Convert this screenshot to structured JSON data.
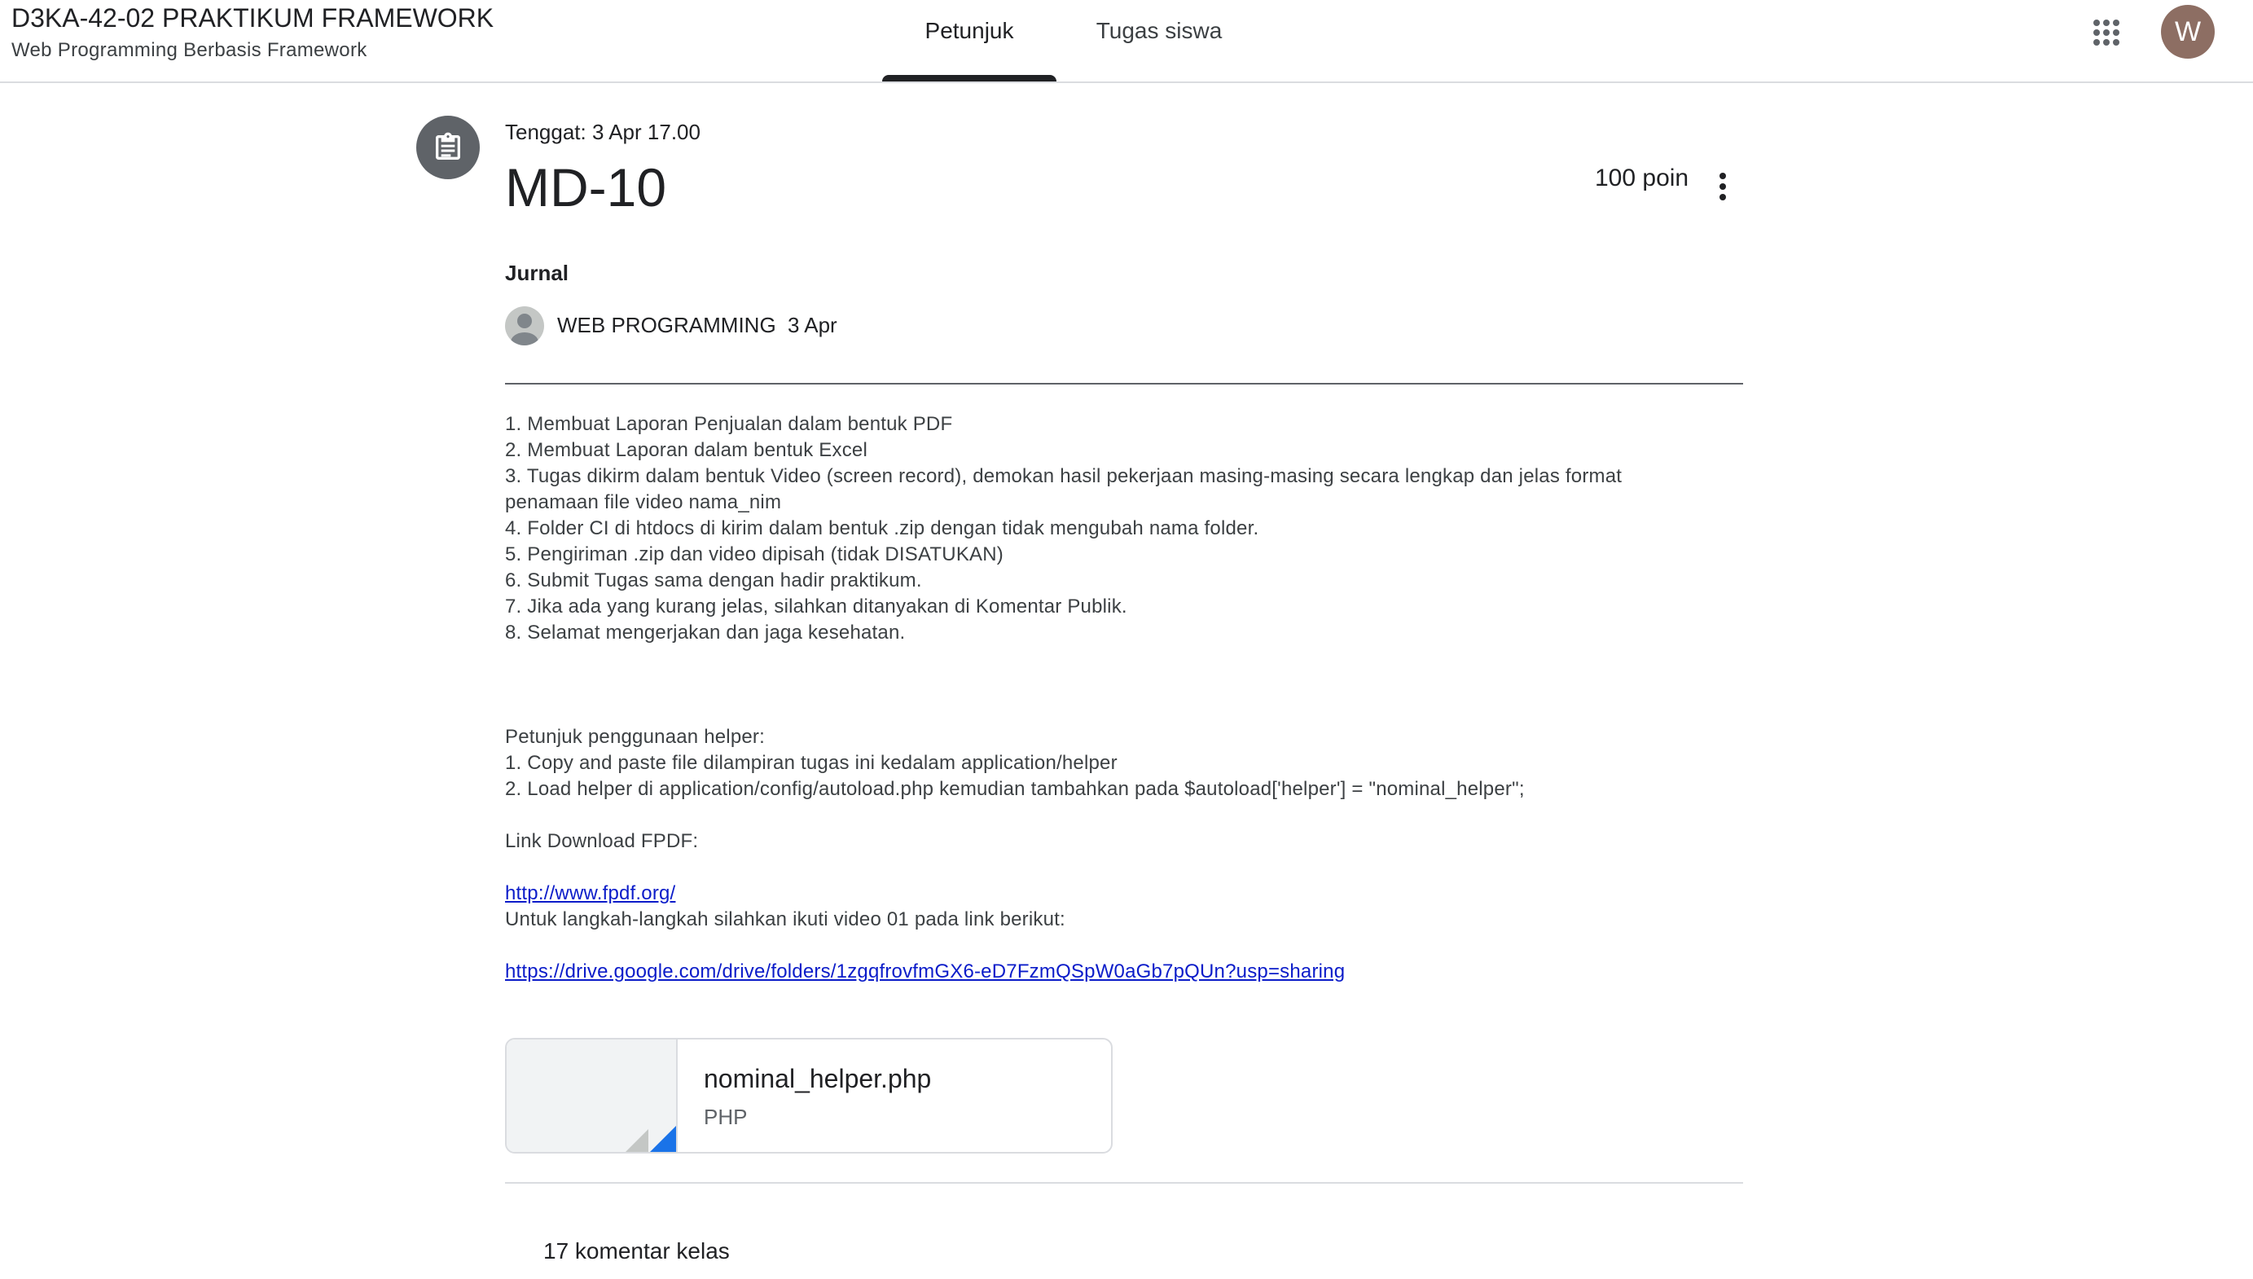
{
  "header": {
    "class_title": "D3KA-42-02 PRAKTIKUM FRAMEWORK",
    "class_subtitle": "Web Programming Berbasis Framework",
    "tabs": [
      {
        "label": "Petunjuk",
        "active": true
      },
      {
        "label": "Tugas siswa",
        "active": false
      }
    ],
    "apps_icon": "apps-grid-icon",
    "avatar_letter": "W",
    "avatar_color": "#8d6e63"
  },
  "assignment": {
    "icon": "assignment-clipboard-icon",
    "due": "Tenggat: 3 Apr 17.00",
    "title": "MD-10",
    "points": "100 poin",
    "topic": "Jurnal",
    "author": "WEB PROGRAMMING",
    "posted_date": "3 Apr"
  },
  "description": {
    "lines": [
      "1. Membuat Laporan Penjualan dalam bentuk PDF",
      "2. Membuat Laporan dalam bentuk Excel",
      "3. Tugas dikirm dalam bentuk Video (screen record), demokan hasil pekerjaan masing-masing secara lengkap dan jelas format",
      "penamaan file video nama_nim",
      "4. Folder CI di htdocs di kirim dalam bentuk .zip dengan tidak mengubah nama folder.",
      "5. Pengiriman .zip dan video dipisah (tidak DISATUKAN)",
      "6. Submit Tugas sama dengan hadir praktikum.",
      "7. Jika ada yang kurang jelas, silahkan ditanyakan di Komentar Publik.",
      "8. Selamat mengerjakan dan jaga kesehatan."
    ],
    "helper_heading": "Petunjuk penggunaan helper:",
    "helper_lines": [
      "1. Copy and paste file dilampiran tugas ini kedalam application/helper",
      "2. Load helper di application/config/autoload.php kemudian tambahkan pada $autoload['helper'] = \"nominal_helper\";"
    ],
    "fpdf_heading": "Link Download FPDF:",
    "fpdf_link": "http://www.fpdf.org/",
    "video_text": "Untuk langkah-langkah silahkan ikuti video 01 pada link berikut:",
    "video_link": "https://drive.google.com/drive/folders/1zgqfrovfmGX6-eD7FzmQSpW0aGb7pQUn?usp=sharing"
  },
  "attachment": {
    "name": "nominal_helper.php",
    "type": "PHP"
  },
  "comments": {
    "label": "17 komentar kelas"
  }
}
